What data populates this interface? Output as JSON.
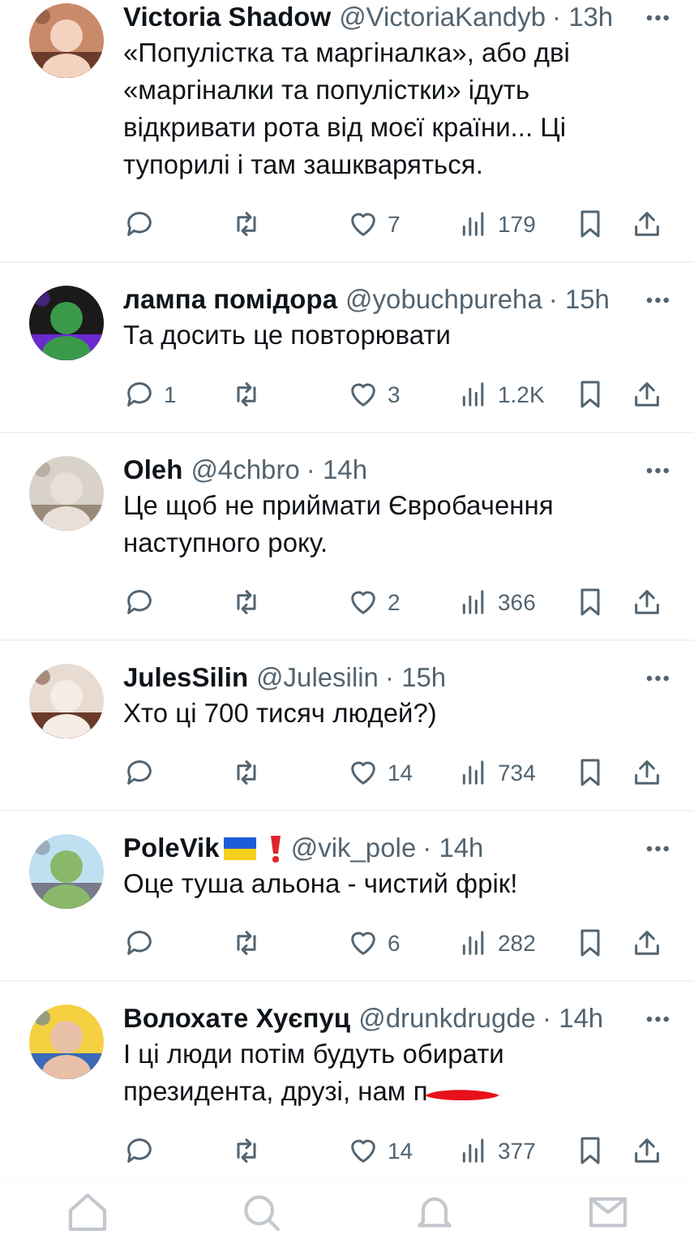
{
  "posts": [
    {
      "name": "Victoria Shadow",
      "handle": "@VictoriaKandyb",
      "time": "· 13h",
      "more": "•••",
      "text": "«Популістка та маргіналка», або дві «маргіналки та популістки» ідуть відкривати рота від моєї країни... Ці тупорилі і там зашкваряться.",
      "redacted": false,
      "stats": {
        "likes": "7",
        "views": "179"
      }
    },
    {
      "name": "лампа помідора",
      "handle": "@yobuchpureha",
      "time": "· 15h",
      "more": "•••",
      "text": "Та досить це повторювати",
      "redacted": false,
      "stats": {
        "replies": "1",
        "likes": "3",
        "views": "1.2K"
      }
    },
    {
      "name": "Oleh",
      "handle": "@4chbro",
      "time": "· 14h",
      "more": "•••",
      "text": "Це щоб не приймати Євробачення наступного року.",
      "redacted": false,
      "stats": {
        "likes": "2",
        "views": "366"
      }
    },
    {
      "name": "JulesSilin",
      "handle": "@Julesilin",
      "time": "· 15h",
      "more": "•••",
      "text": "Хто ці 700 тисяч людей?)",
      "redacted": false,
      "stats": {
        "likes": "14",
        "views": "734"
      }
    },
    {
      "name": "PoleVik",
      "handle": "@vik_pole",
      "time": "· 14h",
      "more": "•••",
      "text": "Оце туша альона - чистий фрік!",
      "redacted": false,
      "badges": [
        {
          "kind": "flag"
        },
        {
          "kind": "exclamation"
        }
      ],
      "stats": {
        "likes": "6",
        "views": "282"
      }
    },
    {
      "name": "Волохате Хуєпуц",
      "handle": "@drunkdrugde",
      "time": "· 14h",
      "more": "•••",
      "text": "І ці люди потім будуть обирати президента, друзі, нам п",
      "redacted": true,
      "stats": {
        "likes": "14",
        "views": "377"
      }
    }
  ]
}
